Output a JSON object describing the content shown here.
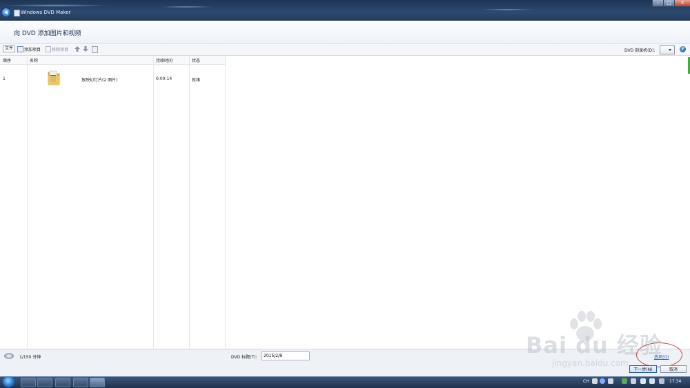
{
  "window": {
    "title": "Windows DVD Maker"
  },
  "header": {
    "title": "向 DVD 添加图片和视频"
  },
  "toolbar": {
    "file_label": "文件",
    "add_label": "添加项目",
    "remove_label": "移除项目",
    "burner_label": "DVD 刻录机(D):",
    "help_label": "?"
  },
  "list": {
    "columns": [
      "顺序",
      "名称",
      "持续时间",
      "状态"
    ],
    "rows": [
      {
        "index": "1",
        "name": "放映幻灯片(2 图片)",
        "duration": "0:00:14",
        "status": "就绪"
      }
    ]
  },
  "footer": {
    "capacity": "1/150 分钟",
    "dvd_title_label": "DVD 标题(T):",
    "dvd_title_value": "2015/2/8",
    "options_label": "选项(O)",
    "next_label": "下一步(N)",
    "cancel_label": "取消"
  },
  "watermark": {
    "brand": "Bai du 经验",
    "url": "jingyan.baidu.com"
  },
  "taskbar": {
    "lang": "CH",
    "clock": "17:34"
  },
  "colors": {
    "accent": "#1b55b5",
    "annotation": "#c24848",
    "titlebar": "#23395a"
  }
}
